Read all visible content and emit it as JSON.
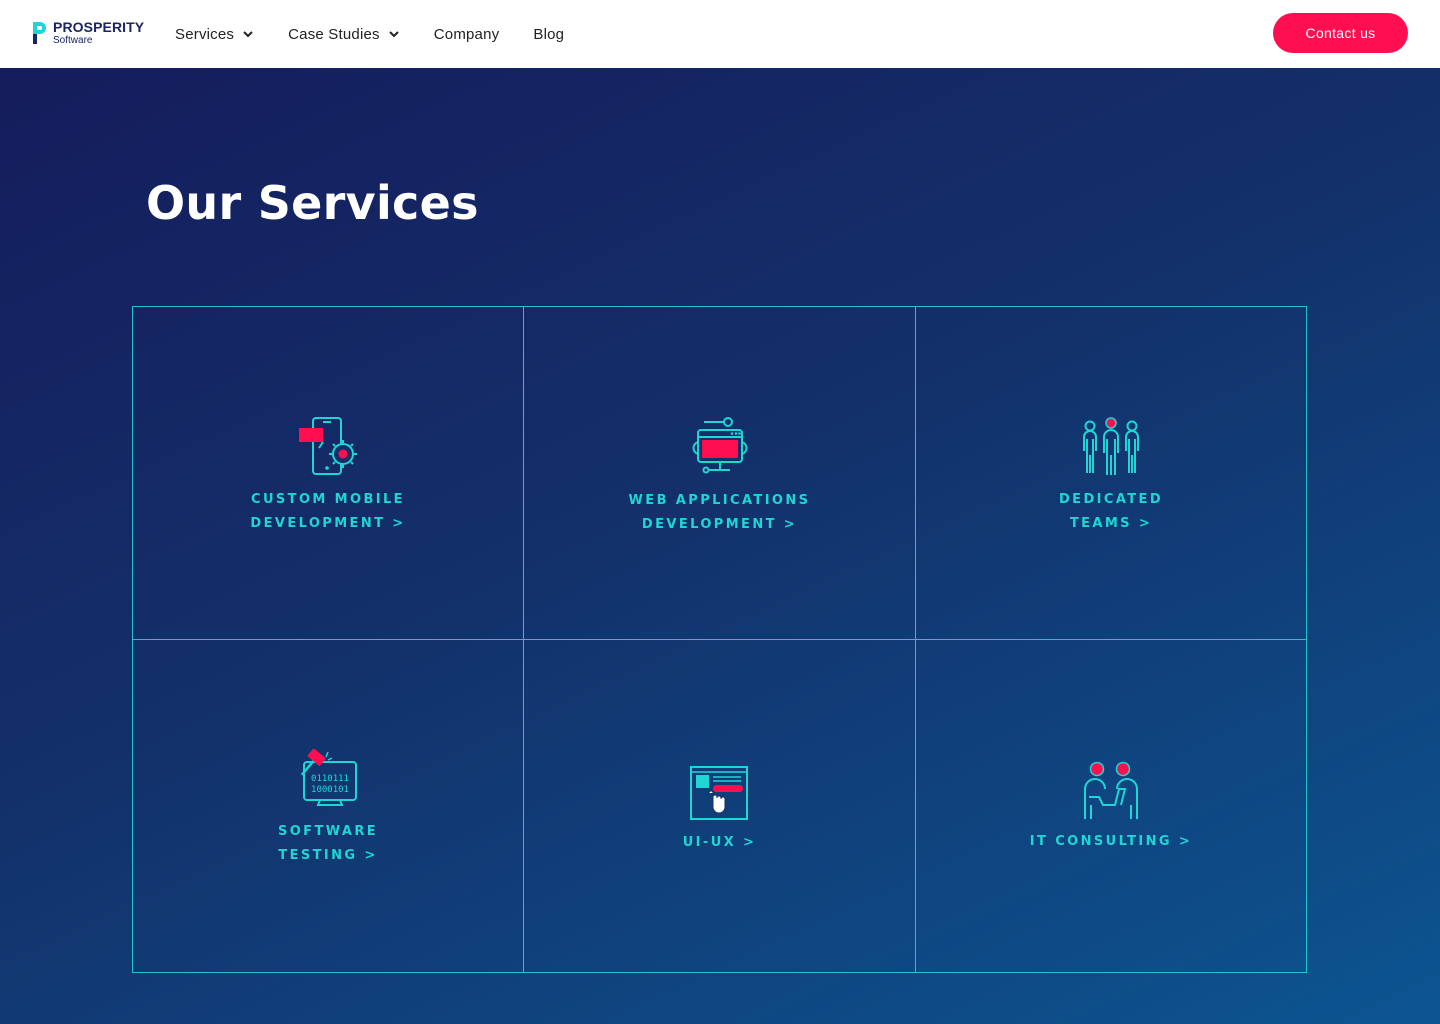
{
  "brand": {
    "name": "PROSPERITY",
    "tagline": "Software"
  },
  "nav": [
    {
      "label": "Services",
      "has_dropdown": true
    },
    {
      "label": "Case Studies",
      "has_dropdown": true
    },
    {
      "label": "Company",
      "has_dropdown": false
    },
    {
      "label": "Blog",
      "has_dropdown": false
    }
  ],
  "contact_button": "Contact us",
  "section_title": "Our Services",
  "services": [
    {
      "line1": "CUSTOM MOBILE",
      "line2": "DEVELOPMENT >",
      "icon": "mobile-gear-icon"
    },
    {
      "line1": "WEB APPLICATIONS",
      "line2": "DEVELOPMENT >",
      "icon": "web-app-icon"
    },
    {
      "line1": "DEDICATED",
      "line2": "TEAMS >",
      "icon": "team-icon"
    },
    {
      "line1": "SOFTWARE",
      "line2": "TESTING >",
      "icon": "testing-icon"
    },
    {
      "line1": "UI-UX >",
      "line2": "",
      "icon": "ui-ux-icon"
    },
    {
      "line1": "IT CONSULTING >",
      "line2": "",
      "icon": "consulting-icon"
    }
  ],
  "testing_icon_text": [
    "0110111",
    "1000101"
  ],
  "colors": {
    "accent": "#ff0f50",
    "teal": "#1fd6d4",
    "navy_dark": "#151c5c",
    "navy_light": "#0c5591",
    "brand_text": "#1b2563"
  }
}
